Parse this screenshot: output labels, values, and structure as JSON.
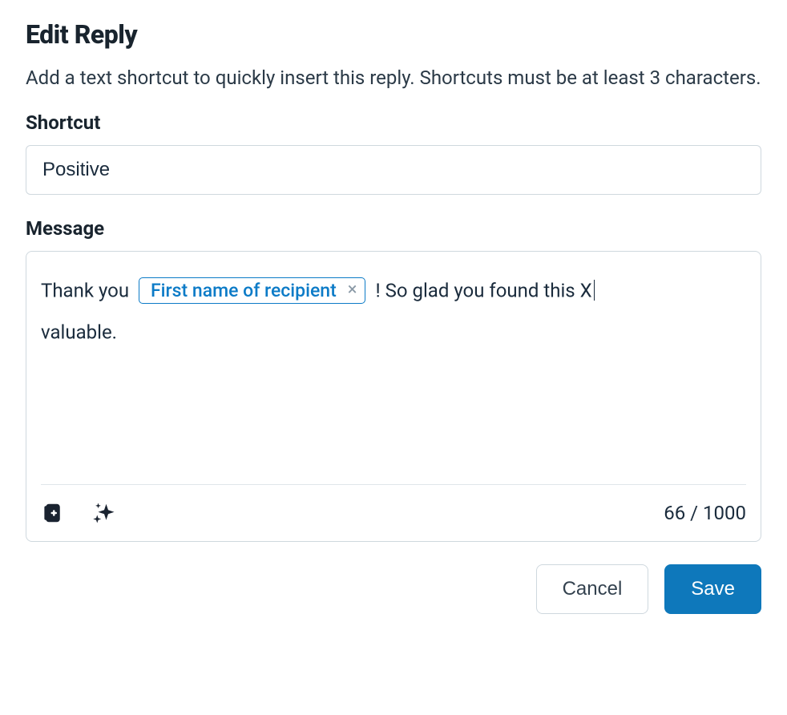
{
  "dialog": {
    "title": "Edit Reply",
    "description": "Add a text shortcut to quickly insert this reply. Shortcuts must be at least 3 characters."
  },
  "shortcut": {
    "label": "Shortcut",
    "value": "Positive"
  },
  "message": {
    "label": "Message",
    "text_before": "Thank you ",
    "variable_label": "First name of recipient",
    "text_after_1": " ! So glad you found this X",
    "text_after_2": "valuable.",
    "char_count": "66 / 1000"
  },
  "actions": {
    "cancel": "Cancel",
    "save": "Save"
  }
}
